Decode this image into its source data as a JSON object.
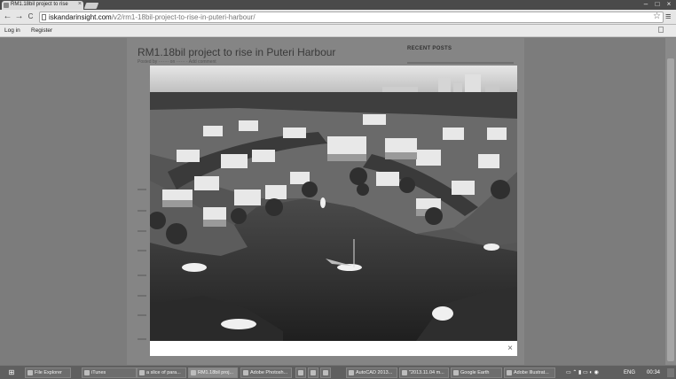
{
  "browser": {
    "tab_title": "RM1.18bil project to rise",
    "tab_close": "×",
    "url_host": "iskandarinsight.com",
    "url_path": "/v2/rm1-18bil-project-to-rise-in-puteri-harbour/",
    "back_glyph": "←",
    "forward_glyph": "→",
    "reload_glyph": "C",
    "star_glyph": "☆",
    "menu_glyph": "≡",
    "minimize_glyph": "–",
    "maximize_glyph": "□",
    "close_glyph": "×"
  },
  "adminbar": {
    "login": "Log in",
    "register": "Register"
  },
  "page": {
    "title": "RM1.18bil project to rise in Puteri Harbour",
    "meta": "Posted by ······· on ······ · Add comment",
    "sidebar_title": "RECENT POSTS"
  },
  "lightbox": {
    "close_glyph": "×"
  },
  "taskbar": {
    "start_glyph": "⊞",
    "items": [
      {
        "label": "File Explorer"
      },
      {
        "label": "iTunes"
      },
      {
        "label": "a slice of para..."
      },
      {
        "label": "RM1.18bil proj..."
      },
      {
        "label": "Adobe Photosh..."
      },
      {
        "label": "AutoCAD 2013..."
      },
      {
        "label": "\"2013.11.04 m..."
      },
      {
        "label": "Google Earth"
      },
      {
        "label": "Adobe Illustrat..."
      }
    ],
    "lang": "ENG",
    "clock": "00:34"
  },
  "colors": {
    "overlay": "#808080",
    "lightbox_bg": "#ffffff",
    "taskbar": "#5f5f5f"
  }
}
